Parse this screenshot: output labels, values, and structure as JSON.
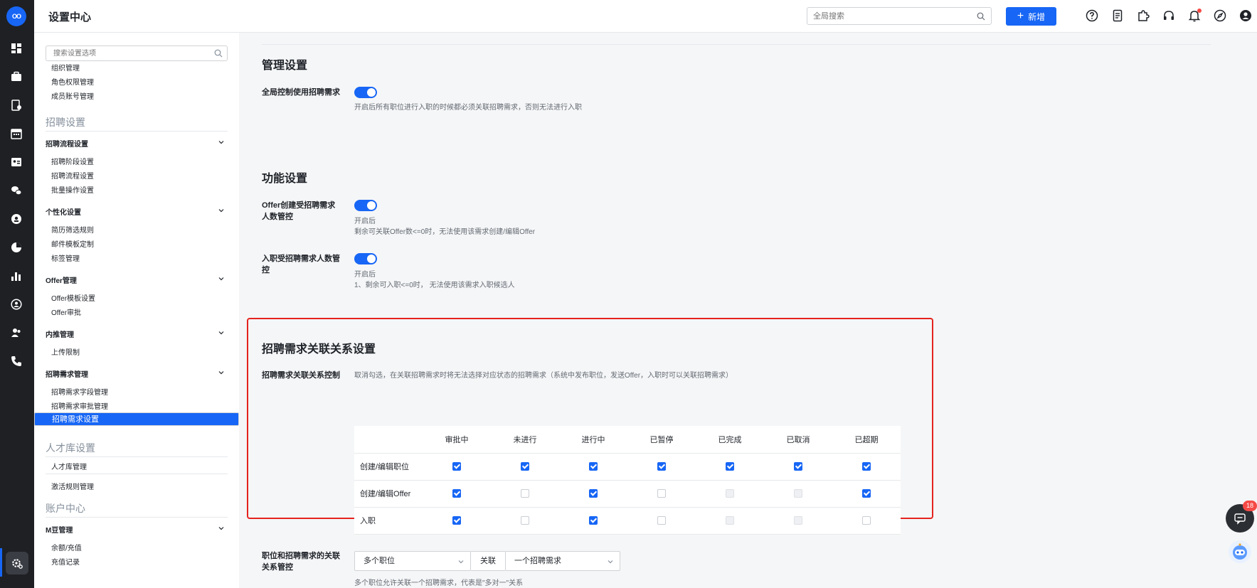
{
  "app": {
    "title": "设置中心",
    "logo_text": "OO"
  },
  "header": {
    "search_placeholder": "全局搜索",
    "new_button_label": "新增",
    "icons": [
      "help-icon",
      "document-icon",
      "plugin-icon",
      "headset-icon",
      "notification-icon",
      "compass-icon",
      "user-icon"
    ]
  },
  "rail": {
    "icons": [
      "dashboard-icon",
      "briefcase-icon",
      "resume-icon",
      "calendar-icon",
      "id-card-icon",
      "wechat-icon",
      "recruit-icon",
      "pie-chart-icon",
      "bar-chart-icon",
      "person-circle-icon",
      "users-icon",
      "phone-icon",
      "settings-icon"
    ]
  },
  "sidebar": {
    "search_placeholder": "搜索设置选项",
    "items_top": [
      "组织管理",
      "角色权限管理",
      "成员账号管理"
    ],
    "section_recruit": "招聘设置",
    "groups": [
      {
        "label": "招聘流程设置",
        "items": [
          "招聘阶段设置",
          "招聘流程设置",
          "批量操作设置"
        ]
      },
      {
        "label": "个性化设置",
        "items": [
          "简历筛选规则",
          "邮件模板定制",
          "标签管理"
        ]
      },
      {
        "label": "Offer管理",
        "items": [
          "Offer模板设置",
          "Offer审批"
        ]
      },
      {
        "label": "内推管理",
        "items": [
          "上传限制"
        ]
      },
      {
        "label": "招聘需求管理",
        "items": [
          "招聘需求字段管理",
          "招聘需求审批管理",
          "招聘需求设置"
        ]
      }
    ],
    "section_talent": "人才库设置",
    "talent_items": [
      "人才库管理",
      "激活规则管理"
    ],
    "section_account": "账户中心",
    "account_group": {
      "label": "M豆管理",
      "items": [
        "余额/充值",
        "充值记录"
      ]
    }
  },
  "main": {
    "admin": {
      "title": "管理设置",
      "global_label": "全局控制使用招聘需求",
      "global_on": true,
      "global_desc": "开启后所有职位进行入职的时候都必须关联招聘需求，否则无法进行入职"
    },
    "func": {
      "title": "功能设置",
      "offer_label": "Offer创建受招聘需求人数管控",
      "offer_on": true,
      "offer_desc1": "开启后",
      "offer_desc2": "剩余可关联Offer数<=0时，无法使用该需求创建/编辑Offer",
      "hire_label": "入职受招聘需求人数管控",
      "hire_on": true,
      "hire_desc1": "开启后",
      "hire_desc2": "1、剩余可入职<=0时， 无法使用该需求入职候选人"
    },
    "relation": {
      "title": "招聘需求关联关系设置",
      "control_label": "招聘需求关联关系控制",
      "control_desc": "取消勾选，在关联招聘需求时将无法选择对应状态的招聘需求（系统中发布职位，发送Offer，入职时可以关联招聘需求）",
      "columns": [
        "审批中",
        "未进行",
        "进行中",
        "已暂停",
        "已完成",
        "已取消",
        "已超期"
      ],
      "rows": [
        {
          "label": "创建/编辑职位",
          "cells": [
            "on",
            "on",
            "on",
            "on",
            "on",
            "on",
            "on"
          ]
        },
        {
          "label": "创建/编辑Offer",
          "cells": [
            "on",
            "off",
            "on",
            "off",
            "disabled",
            "disabled",
            "on"
          ]
        },
        {
          "label": "入职",
          "cells": [
            "on",
            "off",
            "on",
            "off",
            "disabled",
            "disabled",
            "off"
          ]
        }
      ]
    },
    "link": {
      "label": "职位和招聘需求的关联关系管控",
      "select_left": "多个职位",
      "join_label": "关联",
      "select_right": "一个招聘需求",
      "desc": "多个职位允许关联一个招聘需求，代表是\"多对一\"关系"
    }
  },
  "float": {
    "chat_badge": "18"
  },
  "colors": {
    "accent": "#1766f5",
    "highlight_border": "#e5231f",
    "rail_bg": "#1e2024"
  }
}
